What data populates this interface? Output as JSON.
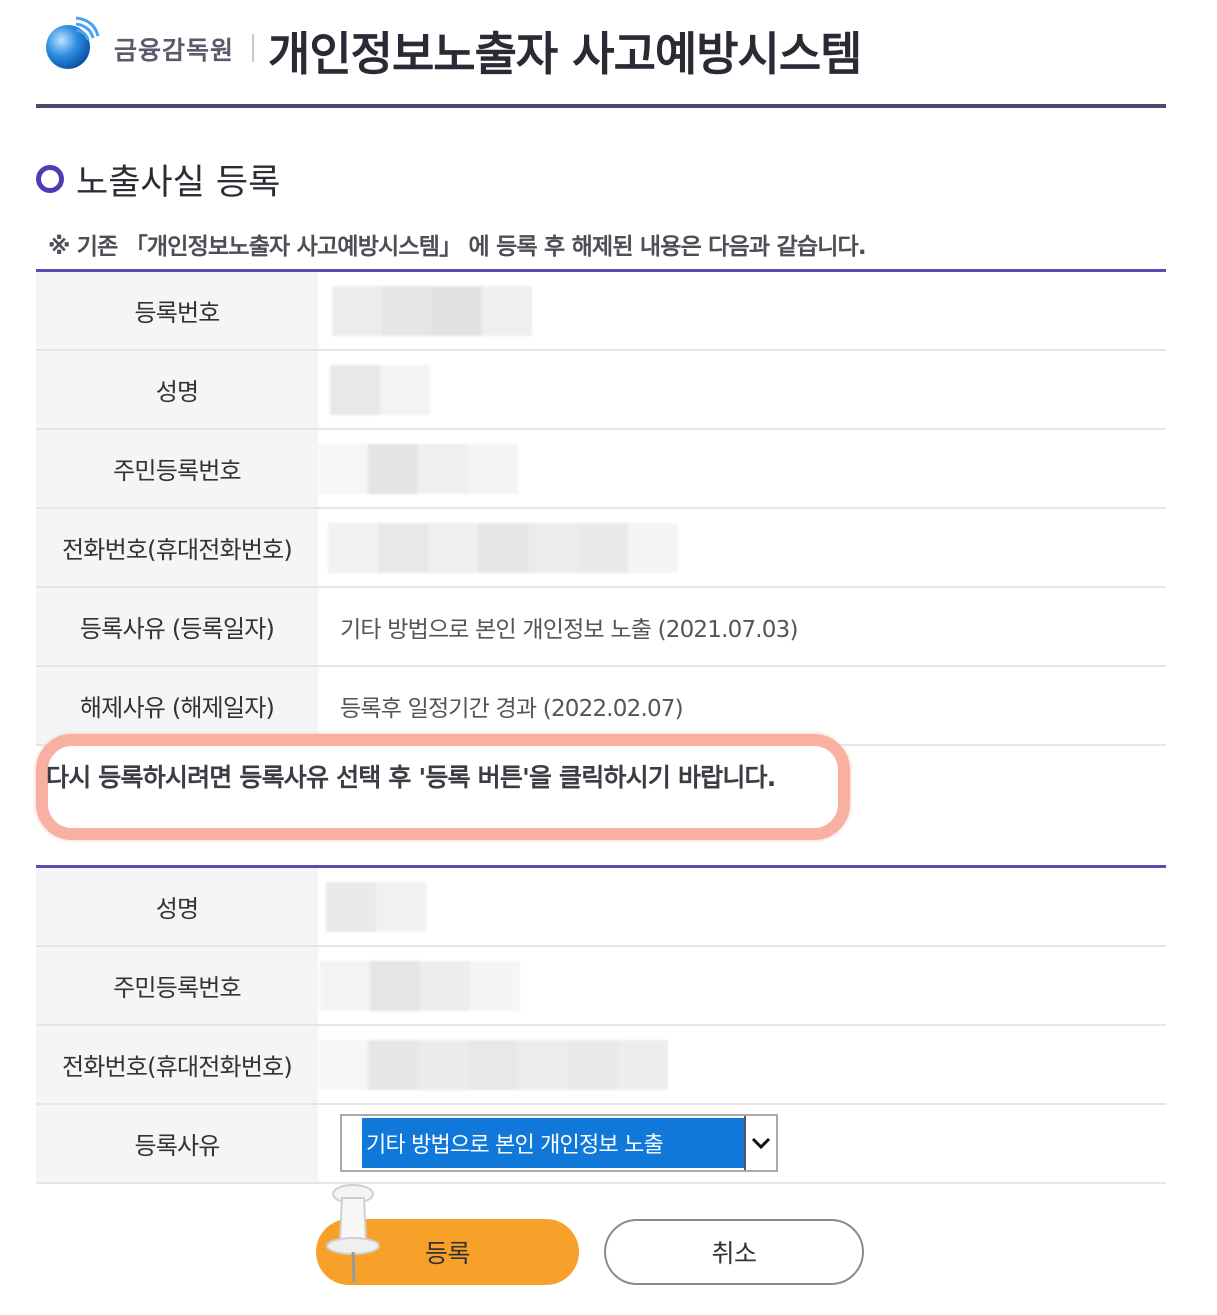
{
  "header": {
    "org_name": "금융감독원",
    "system_title": "개인정보노출자 사고예방시스템"
  },
  "section": {
    "title": "노출사실 등록",
    "notice": "※ 기존 「개인정보노출자 사고예방시스템」 에 등록 후 해제된 내용은 다음과 같습니다."
  },
  "existing_record": {
    "labels": {
      "registration_no": "등록번호",
      "name": "성명",
      "resident_no": "주민등록번호",
      "phone": "전화번호(휴대전화번호)",
      "reg_reason": "등록사유 (등록일자)",
      "release_reason": "해제사유 (해제일자)"
    },
    "values": {
      "reg_reason": "기타 방법으로 본인 개인정보 노출 (2021.07.03)",
      "release_reason": "등록후 일정기간 경과 (2022.02.07)"
    }
  },
  "instruction": "다시 등록하시려면 등록사유 선택 후 '등록 버튼'을 클릭하시기 바랍니다.",
  "new_record": {
    "labels": {
      "name": "성명",
      "resident_no": "주민등록번호",
      "phone": "전화번호(휴대전화번호)",
      "reg_reason": "등록사유"
    },
    "reason_select": {
      "selected": "기타 방법으로 본인 개인정보 노출"
    }
  },
  "buttons": {
    "register": "등록",
    "cancel": "취소"
  },
  "colors": {
    "accent": "#5a4bb0",
    "button_primary": "#f8a12a",
    "select_highlight": "#0f78d8",
    "highlight_border": "#f7b0a2"
  }
}
